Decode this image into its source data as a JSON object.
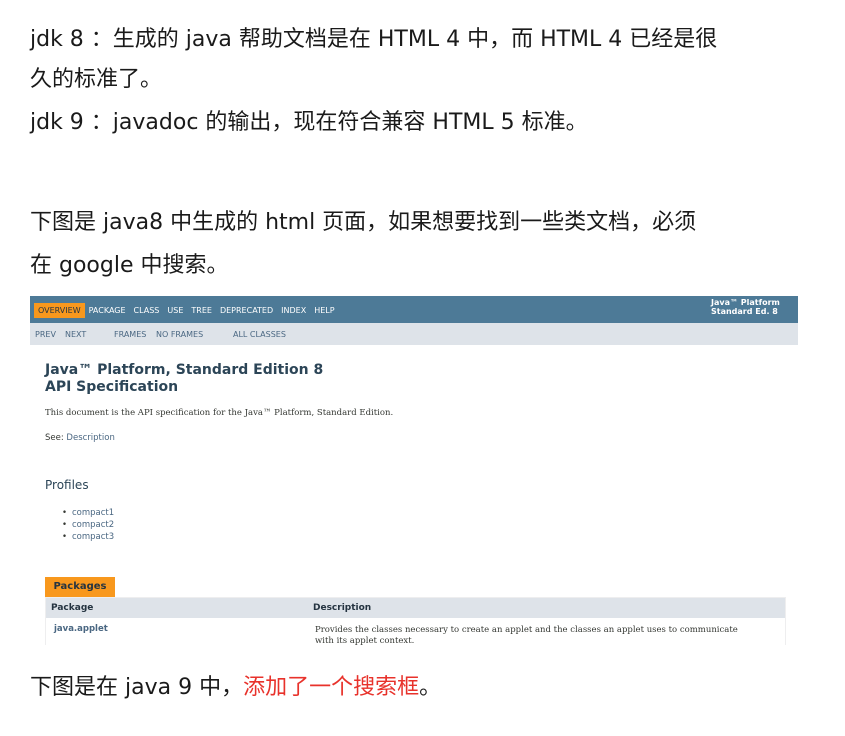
{
  "lines": [
    "jdk 8 ：生成的 java 帮助文档是在 HTML 4 中，而 HTML 4 已经是很",
    "久的标准了。",
    "jdk 9 ：javadoc 的输出，现在符合兼容 HTML 5 标准。",
    "下图是 java8 中生成的 html 页面，如果想要找到一些类文档，必须",
    "在 google 中搜索。"
  ],
  "last_line": {
    "prefix": "下图是在 java 9 中，",
    "highlight": "添加了一个搜索框",
    "suffix": "。"
  },
  "colors": {
    "highlight": "#e8322b",
    "nav_bg": "#4d7a97",
    "active_tab": "#f8981d",
    "subnav_bg": "#dee3e9"
  },
  "screenshot": {
    "nav": [
      "OVERVIEW",
      "PACKAGE",
      "CLASS",
      "USE",
      "TREE",
      "DEPRECATED",
      "INDEX",
      "HELP"
    ],
    "platform": [
      "Java™ Platform",
      "Standard Ed. 8"
    ],
    "subnav": [
      "PREV",
      "NEXT",
      "FRAMES",
      "NO FRAMES",
      "ALL CLASSES"
    ],
    "title": [
      "Java™ Platform, Standard Edition 8",
      "API Specification"
    ],
    "description": "This document is the API specification for the Java™ Platform, Standard Edition.",
    "see_label": "See:",
    "see_link": "Description",
    "profiles_heading": "Profiles",
    "profiles": [
      "compact1",
      "compact2",
      "compact3"
    ],
    "packages_tab": "Packages",
    "table_headers": [
      "Package",
      "Description"
    ],
    "rows": [
      {
        "name": "java.applet",
        "description": "Provides the classes necessary to create an applet and the classes an applet uses to communicate with its applet context."
      }
    ]
  }
}
